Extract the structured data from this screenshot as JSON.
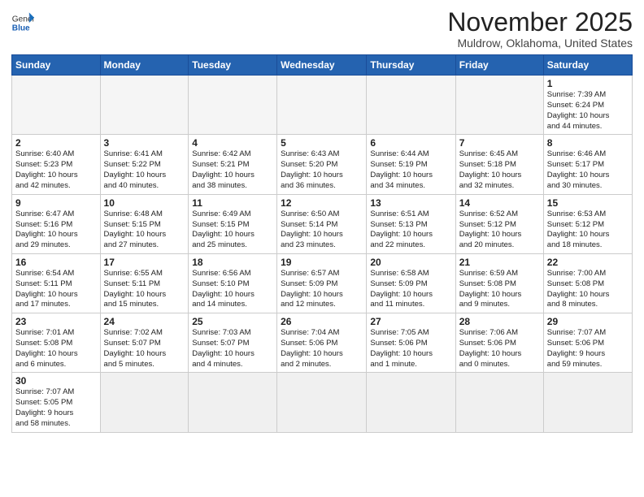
{
  "header": {
    "logo_general": "General",
    "logo_blue": "Blue",
    "month": "November 2025",
    "location": "Muldrow, Oklahoma, United States"
  },
  "weekdays": [
    "Sunday",
    "Monday",
    "Tuesday",
    "Wednesday",
    "Thursday",
    "Friday",
    "Saturday"
  ],
  "weeks": [
    [
      {
        "day": "",
        "info": "",
        "empty": true
      },
      {
        "day": "",
        "info": "",
        "empty": true
      },
      {
        "day": "",
        "info": "",
        "empty": true
      },
      {
        "day": "",
        "info": "",
        "empty": true
      },
      {
        "day": "",
        "info": "",
        "empty": true
      },
      {
        "day": "",
        "info": "",
        "empty": true
      },
      {
        "day": "1",
        "info": "Sunrise: 7:39 AM\nSunset: 6:24 PM\nDaylight: 10 hours\nand 44 minutes."
      }
    ],
    [
      {
        "day": "2",
        "info": "Sunrise: 6:40 AM\nSunset: 5:23 PM\nDaylight: 10 hours\nand 42 minutes."
      },
      {
        "day": "3",
        "info": "Sunrise: 6:41 AM\nSunset: 5:22 PM\nDaylight: 10 hours\nand 40 minutes."
      },
      {
        "day": "4",
        "info": "Sunrise: 6:42 AM\nSunset: 5:21 PM\nDaylight: 10 hours\nand 38 minutes."
      },
      {
        "day": "5",
        "info": "Sunrise: 6:43 AM\nSunset: 5:20 PM\nDaylight: 10 hours\nand 36 minutes."
      },
      {
        "day": "6",
        "info": "Sunrise: 6:44 AM\nSunset: 5:19 PM\nDaylight: 10 hours\nand 34 minutes."
      },
      {
        "day": "7",
        "info": "Sunrise: 6:45 AM\nSunset: 5:18 PM\nDaylight: 10 hours\nand 32 minutes."
      },
      {
        "day": "8",
        "info": "Sunrise: 6:46 AM\nSunset: 5:17 PM\nDaylight: 10 hours\nand 30 minutes."
      }
    ],
    [
      {
        "day": "9",
        "info": "Sunrise: 6:47 AM\nSunset: 5:16 PM\nDaylight: 10 hours\nand 29 minutes."
      },
      {
        "day": "10",
        "info": "Sunrise: 6:48 AM\nSunset: 5:15 PM\nDaylight: 10 hours\nand 27 minutes."
      },
      {
        "day": "11",
        "info": "Sunrise: 6:49 AM\nSunset: 5:15 PM\nDaylight: 10 hours\nand 25 minutes."
      },
      {
        "day": "12",
        "info": "Sunrise: 6:50 AM\nSunset: 5:14 PM\nDaylight: 10 hours\nand 23 minutes."
      },
      {
        "day": "13",
        "info": "Sunrise: 6:51 AM\nSunset: 5:13 PM\nDaylight: 10 hours\nand 22 minutes."
      },
      {
        "day": "14",
        "info": "Sunrise: 6:52 AM\nSunset: 5:12 PM\nDaylight: 10 hours\nand 20 minutes."
      },
      {
        "day": "15",
        "info": "Sunrise: 6:53 AM\nSunset: 5:12 PM\nDaylight: 10 hours\nand 18 minutes."
      }
    ],
    [
      {
        "day": "16",
        "info": "Sunrise: 6:54 AM\nSunset: 5:11 PM\nDaylight: 10 hours\nand 17 minutes."
      },
      {
        "day": "17",
        "info": "Sunrise: 6:55 AM\nSunset: 5:11 PM\nDaylight: 10 hours\nand 15 minutes."
      },
      {
        "day": "18",
        "info": "Sunrise: 6:56 AM\nSunset: 5:10 PM\nDaylight: 10 hours\nand 14 minutes."
      },
      {
        "day": "19",
        "info": "Sunrise: 6:57 AM\nSunset: 5:09 PM\nDaylight: 10 hours\nand 12 minutes."
      },
      {
        "day": "20",
        "info": "Sunrise: 6:58 AM\nSunset: 5:09 PM\nDaylight: 10 hours\nand 11 minutes."
      },
      {
        "day": "21",
        "info": "Sunrise: 6:59 AM\nSunset: 5:08 PM\nDaylight: 10 hours\nand 9 minutes."
      },
      {
        "day": "22",
        "info": "Sunrise: 7:00 AM\nSunset: 5:08 PM\nDaylight: 10 hours\nand 8 minutes."
      }
    ],
    [
      {
        "day": "23",
        "info": "Sunrise: 7:01 AM\nSunset: 5:08 PM\nDaylight: 10 hours\nand 6 minutes."
      },
      {
        "day": "24",
        "info": "Sunrise: 7:02 AM\nSunset: 5:07 PM\nDaylight: 10 hours\nand 5 minutes."
      },
      {
        "day": "25",
        "info": "Sunrise: 7:03 AM\nSunset: 5:07 PM\nDaylight: 10 hours\nand 4 minutes."
      },
      {
        "day": "26",
        "info": "Sunrise: 7:04 AM\nSunset: 5:06 PM\nDaylight: 10 hours\nand 2 minutes."
      },
      {
        "day": "27",
        "info": "Sunrise: 7:05 AM\nSunset: 5:06 PM\nDaylight: 10 hours\nand 1 minute."
      },
      {
        "day": "28",
        "info": "Sunrise: 7:06 AM\nSunset: 5:06 PM\nDaylight: 10 hours\nand 0 minutes."
      },
      {
        "day": "29",
        "info": "Sunrise: 7:07 AM\nSunset: 5:06 PM\nDaylight: 9 hours\nand 59 minutes."
      }
    ],
    [
      {
        "day": "30",
        "info": "Sunrise: 7:07 AM\nSunset: 5:05 PM\nDaylight: 9 hours\nand 58 minutes."
      },
      {
        "day": "",
        "info": "",
        "empty": true
      },
      {
        "day": "",
        "info": "",
        "empty": true
      },
      {
        "day": "",
        "info": "",
        "empty": true
      },
      {
        "day": "",
        "info": "",
        "empty": true
      },
      {
        "day": "",
        "info": "",
        "empty": true
      },
      {
        "day": "",
        "info": "",
        "empty": true
      }
    ]
  ]
}
